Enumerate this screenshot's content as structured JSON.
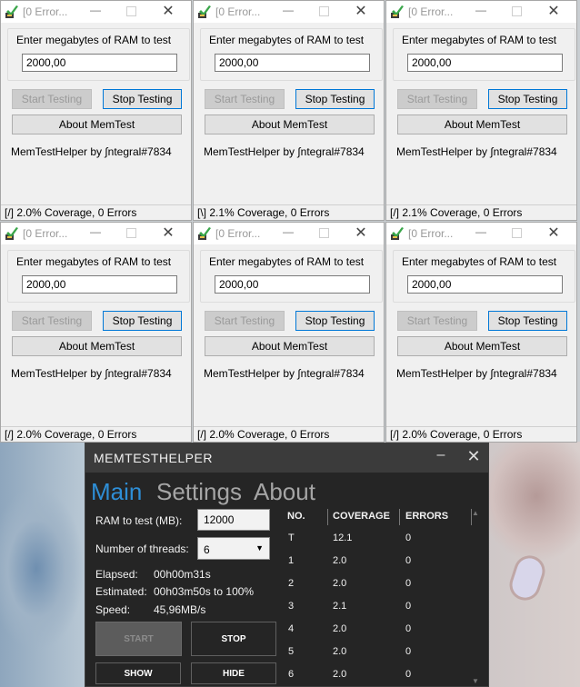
{
  "colors": {
    "accent": "#2e8ed6",
    "helper_bg": "#252525"
  },
  "small_windows": [
    {
      "title": "[0 Error...",
      "label": "Enter megabytes of RAM to test",
      "value": "2000,00",
      "start": "Start Testing",
      "stop": "Stop Testing",
      "about": "About MemTest",
      "credit": "MemTestHelper by ∫ntegral#7834",
      "status": "[/]   2.0% Coverage, 0 Errors"
    },
    {
      "title": "[0 Error...",
      "label": "Enter megabytes of RAM to test",
      "value": "2000,00",
      "start": "Start Testing",
      "stop": "Stop Testing",
      "about": "About MemTest",
      "credit": "MemTestHelper by ∫ntegral#7834",
      "status": "[\\]   2.1% Coverage, 0 Errors"
    },
    {
      "title": "[0 Error...",
      "label": "Enter megabytes of RAM to test",
      "value": "2000,00",
      "start": "Start Testing",
      "stop": "Stop Testing",
      "about": "About MemTest",
      "credit": "MemTestHelper by ∫ntegral#7834",
      "status": "[/]   2.1% Coverage, 0 Errors"
    },
    {
      "title": "[0 Error...",
      "label": "Enter megabytes of RAM to test",
      "value": "2000,00",
      "start": "Start Testing",
      "stop": "Stop Testing",
      "about": "About MemTest",
      "credit": "MemTestHelper by ∫ntegral#7834",
      "status": "[/]   2.0% Coverage, 0 Errors"
    },
    {
      "title": "[0 Error...",
      "label": "Enter megabytes of RAM to test",
      "value": "2000,00",
      "start": "Start Testing",
      "stop": "Stop Testing",
      "about": "About MemTest",
      "credit": "MemTestHelper by ∫ntegral#7834",
      "status": "[/]   2.0% Coverage, 0 Errors"
    },
    {
      "title": "[0 Error...",
      "label": "Enter megabytes of RAM to test",
      "value": "2000,00",
      "start": "Start Testing",
      "stop": "Stop Testing",
      "about": "About MemTest",
      "credit": "MemTestHelper by ∫ntegral#7834",
      "status": "[/]   2.0% Coverage, 0 Errors"
    }
  ],
  "helper": {
    "title": "MEMTESTHELPER",
    "minimize": "–",
    "close": "✕",
    "tabs": [
      "Main",
      "Settings",
      "About"
    ],
    "ram_label": "RAM to test (MB):",
    "ram_value": "12000",
    "threads_label": "Number of threads:",
    "threads_value": "6",
    "elapsed_label": "Elapsed:",
    "elapsed_value": "00h00m31s",
    "estimated_label": "Estimated:",
    "estimated_value": "00h03m50s to 100%",
    "speed_label": "Speed:",
    "speed_value": "45,96MB/s",
    "start": "START",
    "stop": "STOP",
    "show": "SHOW",
    "hide": "HIDE",
    "columns": [
      "NO.",
      "COVERAGE",
      "ERRORS"
    ],
    "rows": [
      {
        "no": "T",
        "coverage": "12.1",
        "errors": "0"
      },
      {
        "no": "1",
        "coverage": "2.0",
        "errors": "0"
      },
      {
        "no": "2",
        "coverage": "2.0",
        "errors": "0"
      },
      {
        "no": "3",
        "coverage": "2.1",
        "errors": "0"
      },
      {
        "no": "4",
        "coverage": "2.0",
        "errors": "0"
      },
      {
        "no": "5",
        "coverage": "2.0",
        "errors": "0"
      },
      {
        "no": "6",
        "coverage": "2.0",
        "errors": "0"
      }
    ]
  }
}
